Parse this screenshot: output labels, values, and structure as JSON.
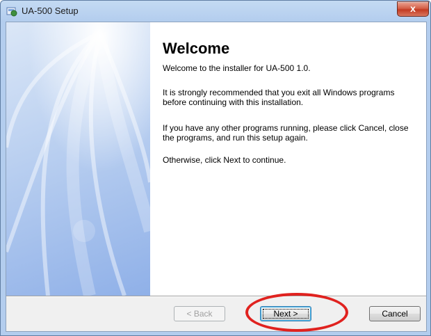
{
  "window": {
    "title": "UA-500 Setup",
    "close_glyph": "x"
  },
  "content": {
    "heading": "Welcome",
    "paragraphs": [
      "Welcome to the installer for UA-500 1.0.",
      "It is strongly recommended that you exit all Windows programs before continuing with this installation.",
      "If you have any other programs running, please click Cancel, close the programs, and run this setup again.",
      "Otherwise, click Next to continue."
    ]
  },
  "buttons": {
    "back": {
      "label": "< Back",
      "enabled": false
    },
    "next": {
      "label": "Next >",
      "enabled": true,
      "default": true
    },
    "cancel": {
      "label": "Cancel",
      "enabled": true
    }
  },
  "icons": {
    "app": "installer-icon",
    "close": "close-icon"
  },
  "colors": {
    "highlight": "#e0221f",
    "close_button": "#c33b22"
  }
}
